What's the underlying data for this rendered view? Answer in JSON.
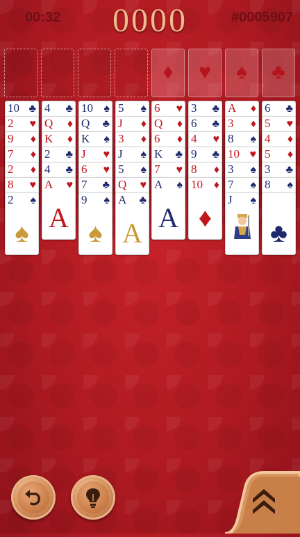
{
  "hud": {
    "timer": "00:32",
    "score": "0000",
    "game_number": "#0005907"
  },
  "free_cells": [
    {
      "name": "free-cell-1"
    },
    {
      "name": "free-cell-2"
    },
    {
      "name": "free-cell-3"
    },
    {
      "name": "free-cell-4"
    }
  ],
  "foundations": [
    {
      "suit": "diamonds",
      "symbol": "♦"
    },
    {
      "suit": "hearts",
      "symbol": "♥"
    },
    {
      "suit": "spades",
      "symbol": "♠"
    },
    {
      "suit": "clubs",
      "symbol": "♣"
    }
  ],
  "tableau": [
    [
      {
        "rank": "10",
        "suit": "♣"
      },
      {
        "rank": "2",
        "suit": "♥"
      },
      {
        "rank": "9",
        "suit": "♦"
      },
      {
        "rank": "7",
        "suit": "♦"
      },
      {
        "rank": "2",
        "suit": "♦"
      },
      {
        "rank": "8",
        "suit": "♥"
      },
      {
        "rank": "2",
        "suit": "♠",
        "face": "♠"
      }
    ],
    [
      {
        "rank": "4",
        "suit": "♣"
      },
      {
        "rank": "Q",
        "suit": "♦"
      },
      {
        "rank": "K",
        "suit": "♦"
      },
      {
        "rank": "2",
        "suit": "♣"
      },
      {
        "rank": "4",
        "suit": "♣"
      },
      {
        "rank": "A",
        "suit": "♥",
        "face": "A"
      }
    ],
    [
      {
        "rank": "10",
        "suit": "♠"
      },
      {
        "rank": "Q",
        "suit": "♣"
      },
      {
        "rank": "K",
        "suit": "♠"
      },
      {
        "rank": "J",
        "suit": "♥"
      },
      {
        "rank": "6",
        "suit": "♥"
      },
      {
        "rank": "7",
        "suit": "♣"
      },
      {
        "rank": "9",
        "suit": "♠",
        "face": "♠"
      }
    ],
    [
      {
        "rank": "5",
        "suit": "♠"
      },
      {
        "rank": "J",
        "suit": "♦"
      },
      {
        "rank": "3",
        "suit": "♦"
      },
      {
        "rank": "J",
        "suit": "♠"
      },
      {
        "rank": "5",
        "suit": "♠"
      },
      {
        "rank": "Q",
        "suit": "♥"
      },
      {
        "rank": "A",
        "suit": "♣",
        "face": "A"
      }
    ],
    [
      {
        "rank": "6",
        "suit": "♥"
      },
      {
        "rank": "Q",
        "suit": "♦"
      },
      {
        "rank": "6",
        "suit": "♦"
      },
      {
        "rank": "K",
        "suit": "♣"
      },
      {
        "rank": "7",
        "suit": "♥"
      },
      {
        "rank": "A",
        "suit": "♠",
        "face": "A"
      }
    ],
    [
      {
        "rank": "3",
        "suit": "♣"
      },
      {
        "rank": "6",
        "suit": "♣"
      },
      {
        "rank": "4",
        "suit": "♥"
      },
      {
        "rank": "9",
        "suit": "♣"
      },
      {
        "rank": "8",
        "suit": "♦"
      },
      {
        "rank": "10",
        "suit": "♦",
        "face": "♦"
      }
    ],
    [
      {
        "rank": "A",
        "suit": "♦"
      },
      {
        "rank": "3",
        "suit": "♦"
      },
      {
        "rank": "8",
        "suit": "♠"
      },
      {
        "rank": "10",
        "suit": "♥"
      },
      {
        "rank": "3",
        "suit": "♠"
      },
      {
        "rank": "7",
        "suit": "♠"
      },
      {
        "rank": "J",
        "suit": "♠",
        "face": "jack"
      }
    ],
    [
      {
        "rank": "6",
        "suit": "♣"
      },
      {
        "rank": "5",
        "suit": "♥"
      },
      {
        "rank": "4",
        "suit": "♦"
      },
      {
        "rank": "5",
        "suit": "♦"
      },
      {
        "rank": "3",
        "suit": "♣"
      },
      {
        "rank": "8",
        "suit": "♠"
      },
      {
        "rank": "",
        "suit": "",
        "face": "♣"
      }
    ]
  ],
  "controls": {
    "undo_icon": "undo-arrow-icon",
    "hint_icon": "lightbulb-icon",
    "menu_icon": "double-chevron-up-icon"
  },
  "colors": {
    "felt": "#b01a22",
    "red_suit": "#c0161d",
    "black_suit": "#1e2a6b",
    "gold": "#c99a3a",
    "button": "#d89562"
  }
}
